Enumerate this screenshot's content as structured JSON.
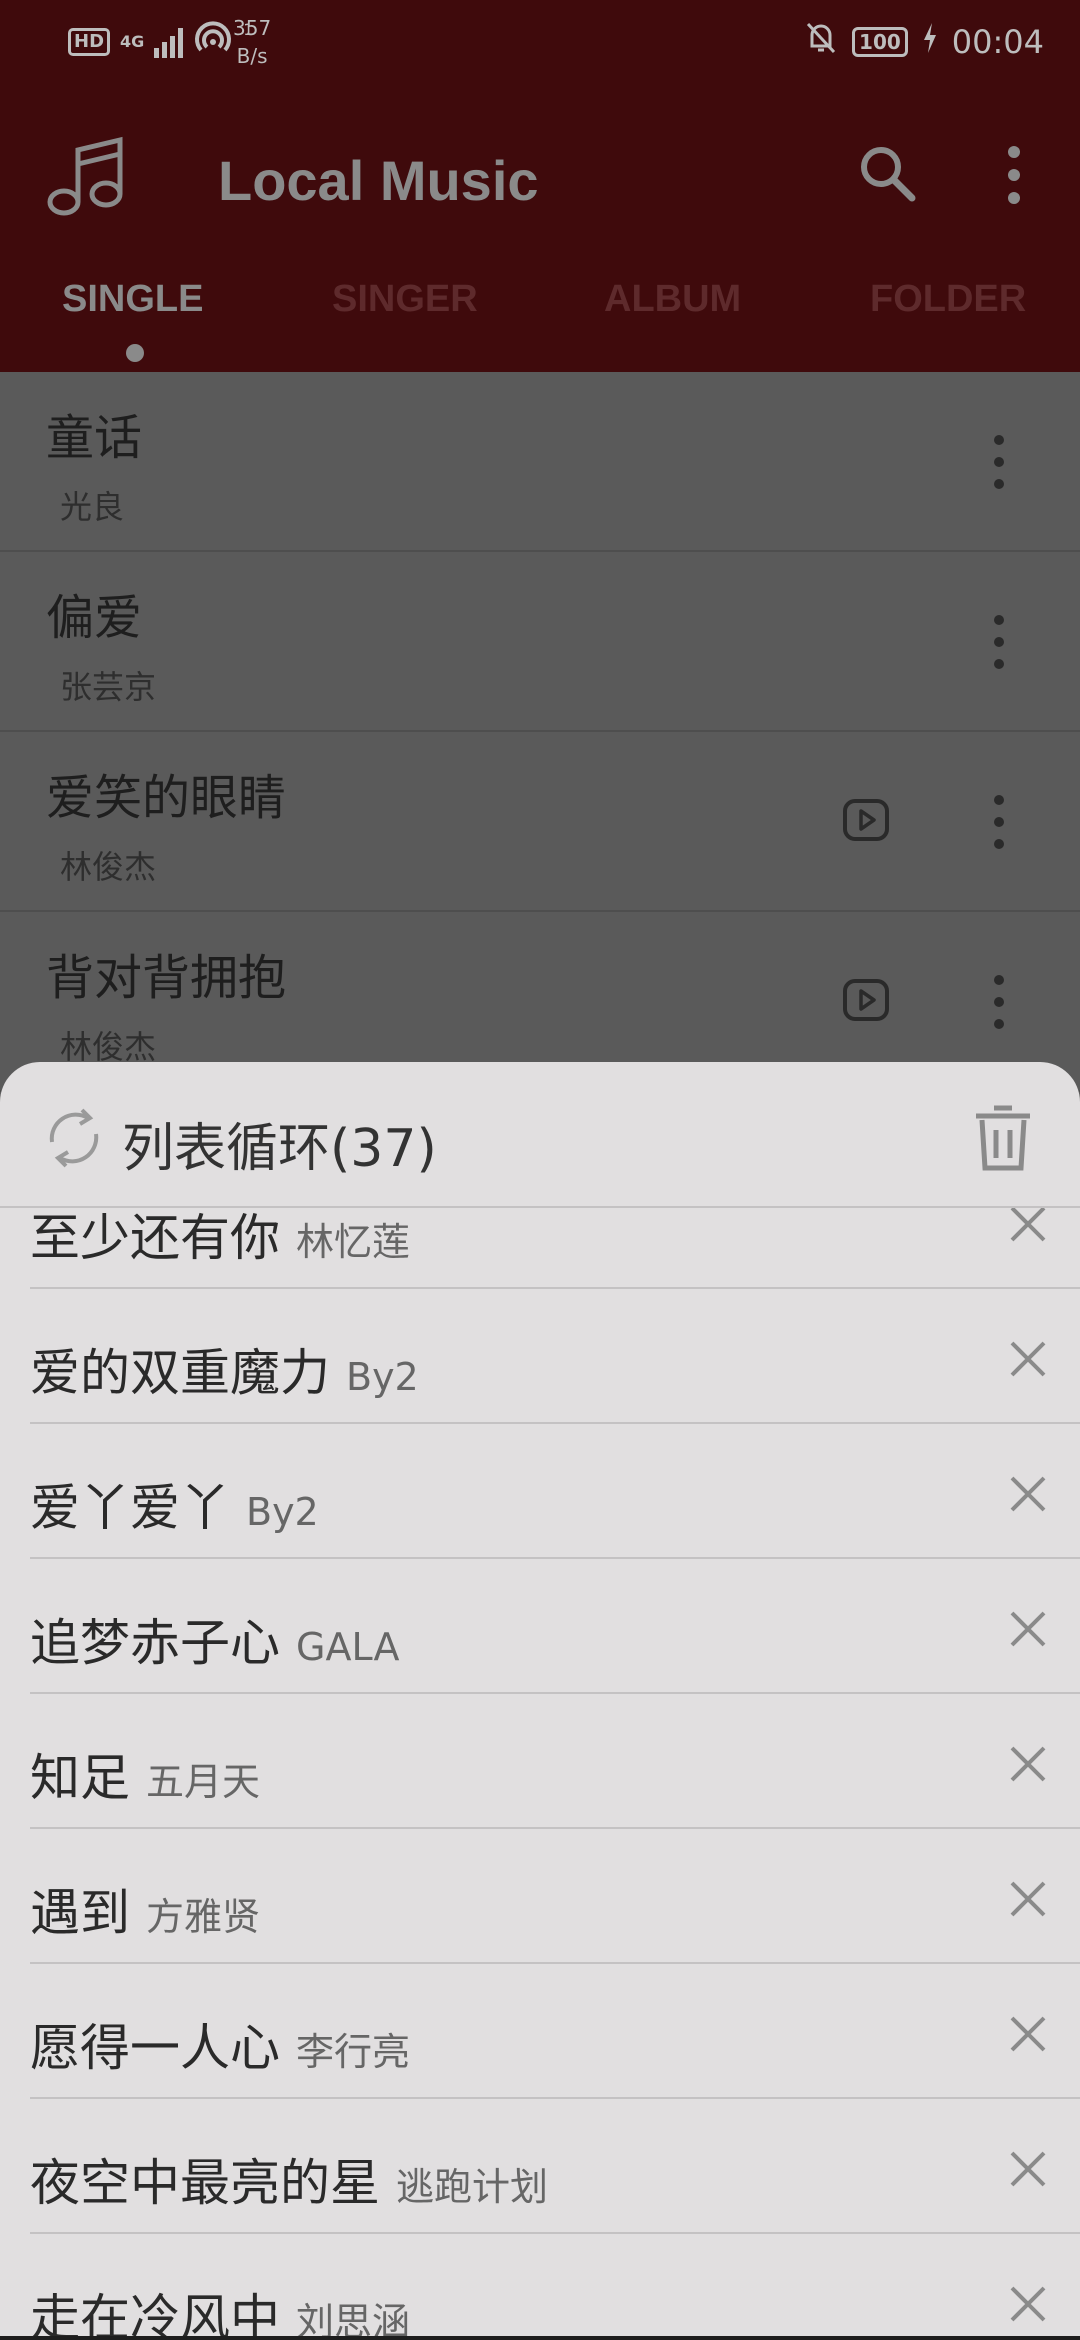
{
  "status_bar": {
    "hd": "HD",
    "network": "4G",
    "wifi_badge": "1",
    "speed_value": "357",
    "speed_unit": "B/s",
    "battery": "100",
    "time": "00:04"
  },
  "app_bar": {
    "title": "Local Music",
    "tabs": [
      "SINGLE",
      "SINGER",
      "ALBUM",
      "FOLDER"
    ],
    "active_tab": "SINGLE"
  },
  "songs": [
    {
      "title": "童话",
      "artist": "光良",
      "has_mv": false
    },
    {
      "title": "偏爱",
      "artist": "张芸京",
      "has_mv": false
    },
    {
      "title": "爱笑的眼睛",
      "artist": "林俊杰",
      "has_mv": true
    },
    {
      "title": "背对背拥抱",
      "artist": "林俊杰",
      "has_mv": true
    }
  ],
  "playlist_sheet": {
    "mode_label": "列表循环(37)",
    "queue": [
      {
        "title": "至少还有你",
        "artist": "林忆莲"
      },
      {
        "title": "爱的双重魔力",
        "artist": "By2"
      },
      {
        "title": "爱丫爱丫",
        "artist": "By2"
      },
      {
        "title": "追梦赤子心",
        "artist": "GALA"
      },
      {
        "title": "知足",
        "artist": "五月天"
      },
      {
        "title": "遇到",
        "artist": "方雅贤"
      },
      {
        "title": "愿得一人心",
        "artist": "李行亮"
      },
      {
        "title": "夜空中最亮的星",
        "artist": "逃跑计划"
      },
      {
        "title": "走在冷风中",
        "artist": "刘思涵"
      }
    ]
  },
  "colors": {
    "app_bar_dimmed": "#3f0a0c",
    "sheet_background": "#e1dfe0",
    "scrim_list": "#5a5a5a"
  }
}
